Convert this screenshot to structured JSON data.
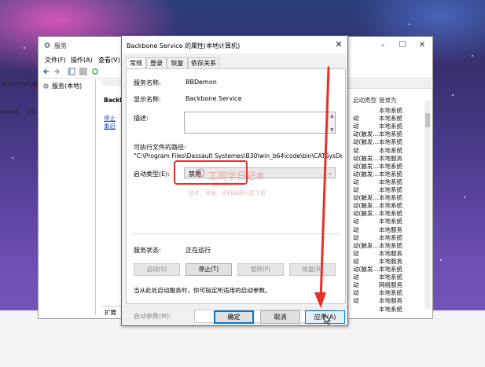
{
  "services_window": {
    "title": "服务",
    "menu": [
      "文件(F)",
      "操作(A)",
      "查看(V)"
    ],
    "tree_item": "服务(本地)",
    "desc_title": "Backbone",
    "desc_links": [
      "停止",
      "重启"
    ],
    "bottom_tab": "扩展",
    "list_headers": [
      "启动类型",
      "登录为"
    ],
    "list_rows": [
      {
        "type": "",
        "login": "本地系统"
      },
      {
        "type": "动",
        "login": "本地系统"
      },
      {
        "type": "动",
        "login": "本地系统"
      },
      {
        "type": "动(触发...",
        "login": "本地系统"
      },
      {
        "type": "动(触发...",
        "login": "本地系统"
      },
      {
        "type": "动",
        "login": "本地系统"
      },
      {
        "type": "动(触发...",
        "login": "本地服务"
      },
      {
        "type": "动(触发...",
        "login": "本地系统"
      },
      {
        "type": "动(触发...",
        "login": "本地系统"
      },
      {
        "type": "动",
        "login": "本地系统"
      },
      {
        "type": "动",
        "login": "本地系统"
      },
      {
        "type": "动(触发...",
        "login": "本地系统"
      },
      {
        "type": "动(触发...",
        "login": "本地系统"
      },
      {
        "type": "动(触发...",
        "login": "本地系统"
      },
      {
        "type": "动",
        "login": "本地系统"
      },
      {
        "type": "动",
        "login": "本地服务"
      },
      {
        "type": "动",
        "login": "本地系统"
      },
      {
        "type": "动(触发...",
        "login": "本地系统"
      },
      {
        "type": "动",
        "login": "本地服务"
      },
      {
        "type": "动",
        "login": "本地服务"
      },
      {
        "type": "动(触发...",
        "login": "本地系统"
      },
      {
        "type": "动",
        "login": "本地系统"
      },
      {
        "type": "动",
        "login": "网络服务"
      },
      {
        "type": "动",
        "login": "本地系统"
      },
      {
        "type": "动",
        "login": "本地服务"
      },
      {
        "type": "",
        "login": "本地系统"
      }
    ],
    "side_texts": [
      "ATIA.P3.V5-6R",
      "R2020",
      "DS.C"
    ]
  },
  "dialog": {
    "title": "Backbone Service 的属性(本地计算机)",
    "tabs": [
      "常规",
      "登录",
      "恢复",
      "依存关系"
    ],
    "service_name_label": "服务名称:",
    "service_name_value": "BBDemon",
    "display_name_label": "显示名称:",
    "display_name_value": "Backbone Service",
    "description_label": "描述:",
    "exe_path_label": "可执行文件的路径:",
    "exe_path_value": "\"C:\\Program Files\\Dassault Systemes\\B30\\win_b64\\code\\bin\\CATSysDe",
    "startup_type_label": "启动类型(E):",
    "startup_type_value": "禁用",
    "service_status_label": "服务状态:",
    "service_status_value": "正在运行",
    "buttons": {
      "start": "启动(S)",
      "stop": "停止(T)",
      "pause": "暂停(P)",
      "resume": "恢复(R)"
    },
    "hint_text": "当从此处启动服务时，你可指定所适用的启动参数。",
    "start_params_label": "启动参数(M):",
    "ok": "确定",
    "cancel": "取消",
    "apply": "应用(A)"
  },
  "watermark": {
    "text": "工同学日记本",
    "sub": "软件、资源、资料网盘分享下载",
    "url": "gtxrjb.com"
  },
  "colors": {
    "highlight": "#e8302a",
    "accent": "#0078d7",
    "link": "#1a4fc7"
  }
}
